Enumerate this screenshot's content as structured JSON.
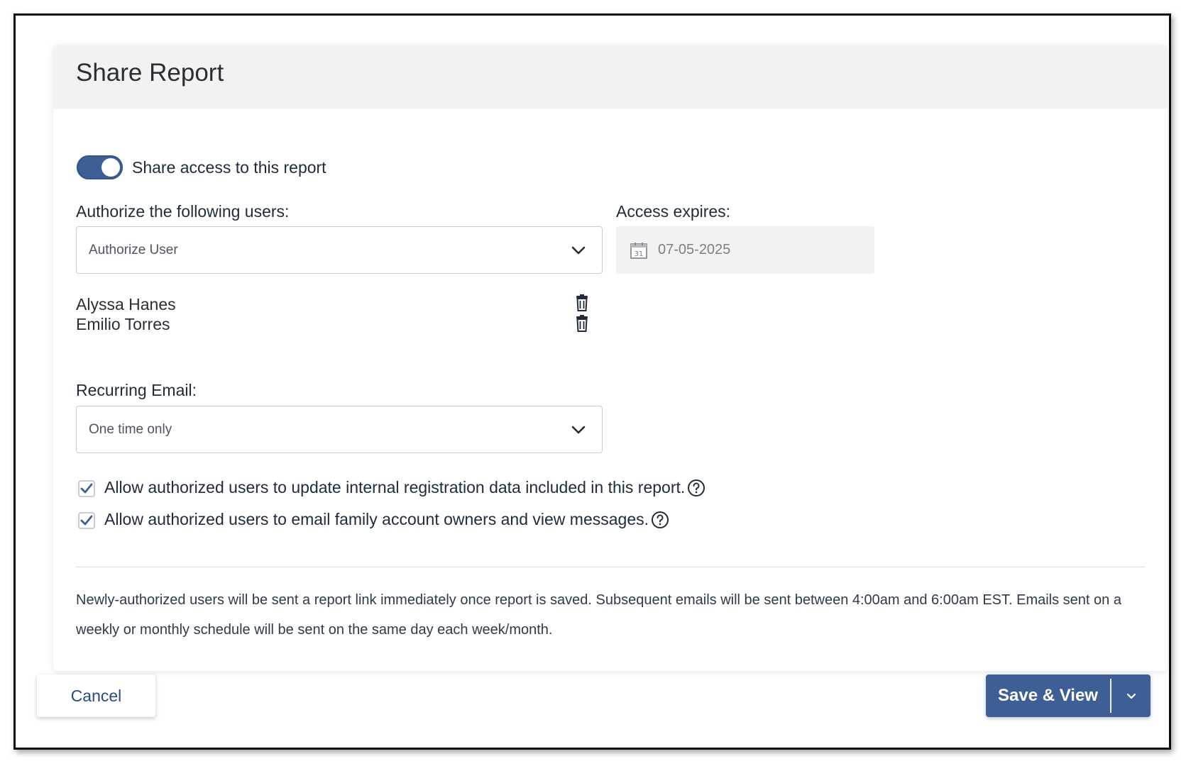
{
  "dialog": {
    "title": "Share Report"
  },
  "share_toggle": {
    "label": "Share access to this report",
    "on": true
  },
  "authorize": {
    "label": "Authorize the following users:",
    "placeholder": "Authorize User",
    "users": [
      {
        "name": "Alyssa Hanes"
      },
      {
        "name": "Emilio Torres"
      }
    ]
  },
  "expires": {
    "label": "Access expires:",
    "value": "07-05-2025",
    "calendar_day": "31"
  },
  "recurring": {
    "label": "Recurring Email:",
    "value": "One time only"
  },
  "options": [
    {
      "label": "Allow authorized users to update internal registration data included in this report.",
      "checked": true
    },
    {
      "label": "Allow authorized users to email family account owners and view messages.",
      "checked": true
    }
  ],
  "note": "Newly-authorized users will be sent a report link immediately once report is saved. Subsequent emails will be sent between 4:00am and 6:00am EST. Emails sent on a weekly or monthly schedule will be sent on the same day each week/month.",
  "footer": {
    "cancel_label": "Cancel",
    "save_label": "Save & View"
  },
  "colors": {
    "accent": "#3d5f95",
    "header_bg": "#f2f2f2",
    "link": "#2a4a80"
  },
  "icons": [
    "chevron-down-icon",
    "calendar-icon",
    "trash-icon",
    "checkbox-checked-icon",
    "help-circle-icon"
  ]
}
